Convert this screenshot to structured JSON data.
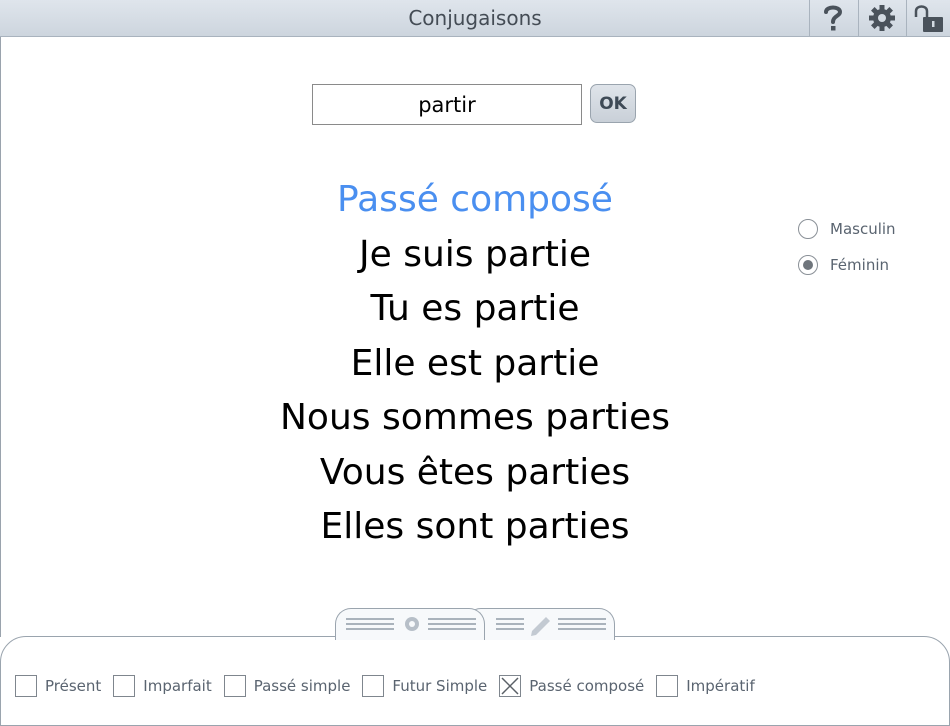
{
  "header": {
    "title": "Conjugaisons",
    "help_icon": "question-mark-icon",
    "settings_icon": "gear-icon",
    "lock_icon": "unlock-icon"
  },
  "search": {
    "value": "partir",
    "ok_label": "OK"
  },
  "conjugation": {
    "tense": "Passé composé",
    "lines": [
      "Je suis partie",
      "Tu es partie",
      "Elle est partie",
      "Nous sommes parties",
      "Vous êtes parties",
      "Elles sont parties"
    ]
  },
  "gender": {
    "options": [
      {
        "label": "Masculin",
        "selected": false
      },
      {
        "label": "Féminin",
        "selected": true
      }
    ]
  },
  "tabs": [
    {
      "icon": "gear-icon",
      "active": true
    },
    {
      "icon": "pencil-icon",
      "active": false
    }
  ],
  "tenses": [
    {
      "label": "Présent",
      "checked": false
    },
    {
      "label": "Imparfait",
      "checked": false
    },
    {
      "label": "Passé simple",
      "checked": false
    },
    {
      "label": "Futur Simple",
      "checked": false
    },
    {
      "label": "Passé composé",
      "checked": true
    },
    {
      "label": "Impératif",
      "checked": false
    }
  ],
  "colors": {
    "accent": "#4a8ff0",
    "header_bg": "#d3dae2",
    "muted_text": "#5a6470"
  }
}
